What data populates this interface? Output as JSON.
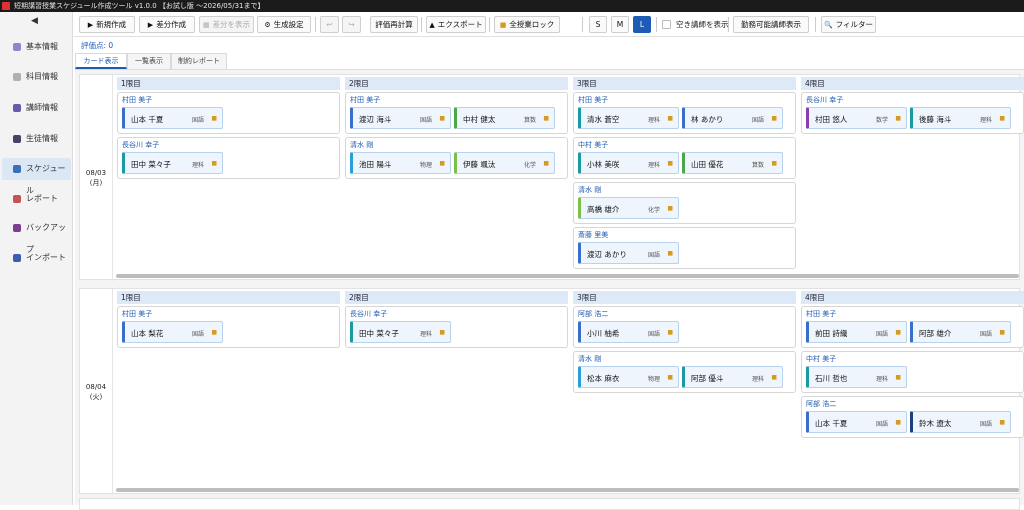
{
  "window": {
    "title": "短期講習授業スケジュール作成ツール v1.0.0 【お試し版 ～2026/05/31まで】"
  },
  "sidebar": {
    "collapse": "◀",
    "items": [
      {
        "label": "基本情報",
        "icon": "#8a8acb"
      },
      {
        "label": "科目情報",
        "icon": "#b0b0b0"
      },
      {
        "label": "講師情報",
        "icon": "#6b5aa8"
      },
      {
        "label": "生徒情報",
        "icon": "#444466"
      },
      {
        "label": "スケジュール",
        "icon": "#3d6fb8",
        "active": true
      },
      {
        "label": "レポート",
        "icon": "#c2554f"
      },
      {
        "label": "バックアップ",
        "icon": "#7a3f8f"
      },
      {
        "label": "インポート",
        "icon": "#3b5fb0"
      }
    ]
  },
  "toolbar": {
    "new": "新規作成",
    "diff": "差分作成",
    "show_diff": "差分を表示",
    "gen_settings": "生成設定",
    "undo": "↩",
    "redo": "↪",
    "recalc": "評価再計算",
    "export": "エクスポート",
    "lock_all": "全授業ロック",
    "size_s": "S",
    "size_m": "M",
    "size_l": "L",
    "empty_teachers": "空き講師を表示",
    "available_teachers": "勤務可能講師表示",
    "filter": "フィルター"
  },
  "score_label": "評価点: 0",
  "view_tabs": [
    "カード表示",
    "一覧表示",
    "制約レポート"
  ],
  "days": [
    {
      "date": "08/03",
      "weekday": "(月)",
      "periods": [
        {
          "label": "1限目",
          "groups": [
            {
              "teacher": "村田 美子",
              "students": [
                {
                  "name": "山本 千夏",
                  "subject": "国語",
                  "color": "#3a6fc9"
                }
              ]
            },
            {
              "teacher": "長谷川 幸子",
              "students": [
                {
                  "name": "田中 菜々子",
                  "subject": "理科",
                  "color": "#1a9aa2"
                }
              ]
            }
          ]
        },
        {
          "label": "2限目",
          "groups": [
            {
              "teacher": "村田 美子",
              "students": [
                {
                  "name": "渡辺 海斗",
                  "subject": "国語",
                  "color": "#3a6fc9"
                },
                {
                  "name": "中村 健太",
                  "subject": "算数",
                  "color": "#4aa84a"
                }
              ]
            },
            {
              "teacher": "清水 剛",
              "students": [
                {
                  "name": "池田 陽斗",
                  "subject": "物理",
                  "color": "#2a9fd6"
                },
                {
                  "name": "伊藤 颯汰",
                  "subject": "化学",
                  "color": "#7bc04a"
                }
              ]
            }
          ]
        },
        {
          "label": "3限目",
          "groups": [
            {
              "teacher": "村田 美子",
              "students": [
                {
                  "name": "清水 蒼空",
                  "subject": "理科",
                  "color": "#1a9aa2"
                },
                {
                  "name": "林 あかり",
                  "subject": "国語",
                  "color": "#3a6fc9"
                }
              ]
            },
            {
              "teacher": "中村 美子",
              "students": [
                {
                  "name": "小林 美咲",
                  "subject": "理科",
                  "color": "#1a9aa2"
                },
                {
                  "name": "山田 優花",
                  "subject": "算数",
                  "color": "#4aa84a"
                }
              ]
            },
            {
              "teacher": "清水 剛",
              "students": [
                {
                  "name": "高橋 雄介",
                  "subject": "化学",
                  "color": "#7bc04a"
                }
              ]
            },
            {
              "teacher": "斎藤 里美",
              "students": [
                {
                  "name": "渡辺 あかり",
                  "subject": "国語",
                  "color": "#3a6fc9"
                }
              ]
            }
          ]
        },
        {
          "label": "4限目",
          "groups": [
            {
              "teacher": "長谷川 幸子",
              "students": [
                {
                  "name": "村田 悠人",
                  "subject": "数学",
                  "color": "#8a3fb0"
                },
                {
                  "name": "後藤 海斗",
                  "subject": "理科",
                  "color": "#1a9aa2"
                }
              ]
            }
          ]
        }
      ]
    },
    {
      "date": "08/04",
      "weekday": "(火)",
      "periods": [
        {
          "label": "1限目",
          "groups": [
            {
              "teacher": "村田 美子",
              "students": [
                {
                  "name": "山本 梨花",
                  "subject": "国語",
                  "color": "#3a6fc9"
                }
              ]
            }
          ]
        },
        {
          "label": "2限目",
          "groups": [
            {
              "teacher": "長谷川 幸子",
              "students": [
                {
                  "name": "田中 菜々子",
                  "subject": "理科",
                  "color": "#1a9aa2"
                }
              ]
            }
          ]
        },
        {
          "label": "3限目",
          "groups": [
            {
              "teacher": "阿部 浩二",
              "students": [
                {
                  "name": "小川 柚希",
                  "subject": "国語",
                  "color": "#3a6fc9"
                }
              ]
            },
            {
              "teacher": "清水 剛",
              "students": [
                {
                  "name": "松本 麻衣",
                  "subject": "物理",
                  "color": "#2a9fd6"
                },
                {
                  "name": "阿部 優斗",
                  "subject": "理科",
                  "color": "#1a9aa2"
                }
              ]
            }
          ]
        },
        {
          "label": "4限目",
          "groups": [
            {
              "teacher": "村田 美子",
              "students": [
                {
                  "name": "前田 詩織",
                  "subject": "国語",
                  "color": "#3a6fc9"
                },
                {
                  "name": "阿部 雄介",
                  "subject": "国語",
                  "color": "#3a6fc9"
                }
              ]
            },
            {
              "teacher": "中村 美子",
              "students": [
                {
                  "name": "石川 哲也",
                  "subject": "理科",
                  "color": "#1a9aa2"
                }
              ]
            },
            {
              "teacher": "阿部 浩二",
              "students": [
                {
                  "name": "山本 千夏",
                  "subject": "国語",
                  "color": "#3a6fc9"
                },
                {
                  "name": "鈴木 遼太",
                  "subject": "国語",
                  "color": "#1d3f80"
                }
              ]
            }
          ]
        }
      ]
    }
  ]
}
